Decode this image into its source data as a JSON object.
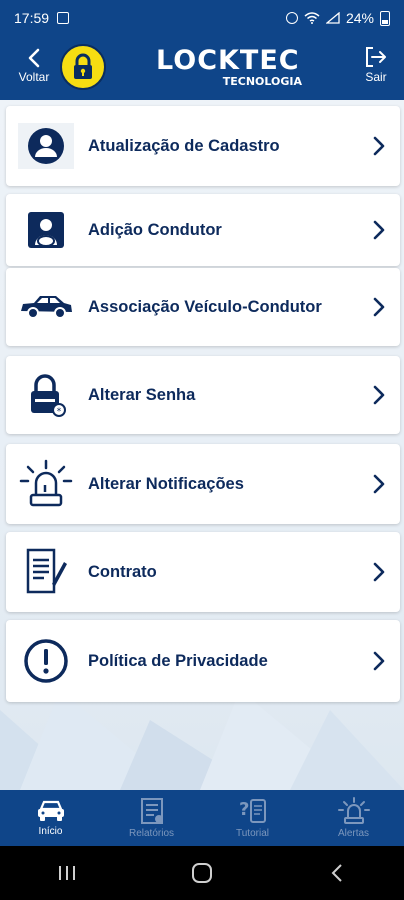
{
  "status_bar": {
    "time": "17:59",
    "battery": "24%"
  },
  "header": {
    "back_label": "Voltar",
    "brand_name": "LOCKTEC",
    "brand_subtitle": "TECNOLOGIA",
    "logout_label": "Sair"
  },
  "menu": {
    "items": [
      {
        "label": "Atualização de Cadastro",
        "icon": "user-icon"
      },
      {
        "label": "Adição Condutor",
        "icon": "driver-icon"
      },
      {
        "label": "Associação Veículo-Condutor",
        "icon": "car-icon"
      },
      {
        "label": "Alterar Senha",
        "icon": "padlock-icon"
      },
      {
        "label": "Alterar Notificações",
        "icon": "alarm-light-icon"
      },
      {
        "label": "Contrato",
        "icon": "contract-icon"
      },
      {
        "label": "Política de Privacidade",
        "icon": "exclamation-icon"
      }
    ]
  },
  "tabs": [
    {
      "label": "Início",
      "icon": "car-icon",
      "active": true
    },
    {
      "label": "Relatórios",
      "icon": "report-icon",
      "active": false
    },
    {
      "label": "Tutorial",
      "icon": "tutorial-icon",
      "active": false
    },
    {
      "label": "Alertas",
      "icon": "alarm-light-icon",
      "active": false
    }
  ],
  "colors": {
    "primary": "#0f4589",
    "text_dark": "#0d2a5c",
    "accent_yellow": "#f6dd12",
    "inactive_tab": "#7c97bd"
  }
}
